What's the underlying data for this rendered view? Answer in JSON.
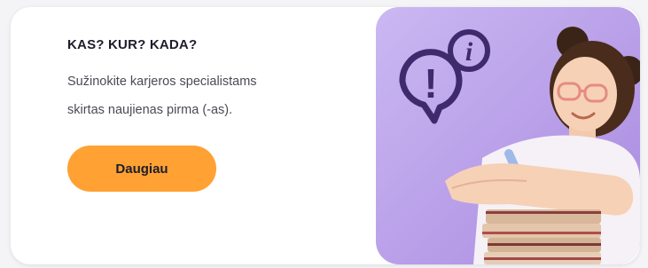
{
  "promo": {
    "heading": "KAS? KUR? KADA?",
    "description_line1": "Sužinokite karjeros specialistams",
    "description_line2": "skirtas naujienas pirma (-as).",
    "button_label": "Daugiau",
    "illustration_glyphs": {
      "exclamation": "!",
      "info": "i"
    }
  },
  "colors": {
    "accent_button": "#ffa133",
    "panel_background": "#b49be6",
    "icon_stroke": "#3f2a6e",
    "heading_text": "#1d1d2b"
  }
}
